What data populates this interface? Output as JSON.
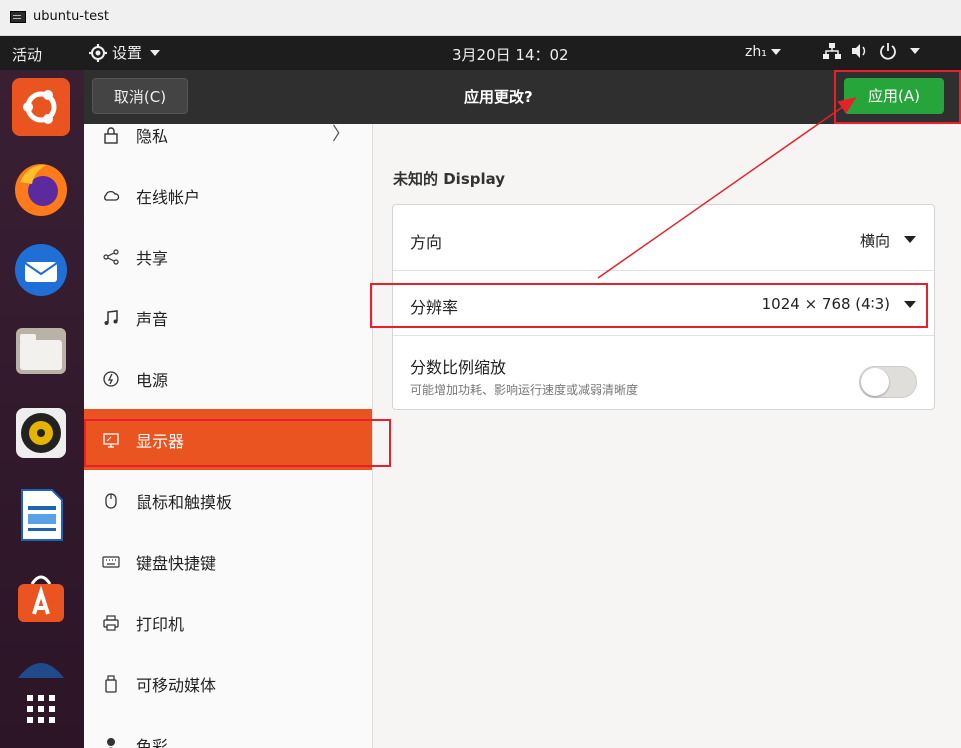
{
  "window": {
    "title": "ubuntu-test"
  },
  "topbar": {
    "activities": "活动",
    "app_menu": "设置",
    "clock": "3月20日 14：02",
    "input_method": "zh₁"
  },
  "header": {
    "cancel_label": "取消(C)",
    "title": "应用更改?",
    "apply_label": "应用(A)",
    "apply_color": "#26a53a"
  },
  "sidebar": {
    "accent_color": "#e95420",
    "items": [
      {
        "label": "隐私",
        "icon": "lock-icon"
      },
      {
        "label": "在线帐户",
        "icon": "cloud-icon"
      },
      {
        "label": "共享",
        "icon": "share-icon"
      },
      {
        "label": "声音",
        "icon": "music-note-icon"
      },
      {
        "label": "电源",
        "icon": "power-icon"
      },
      {
        "label": "显示器",
        "icon": "display-icon",
        "selected": true
      },
      {
        "label": "鼠标和触摸板",
        "icon": "mouse-icon"
      },
      {
        "label": "键盘快捷键",
        "icon": "keyboard-icon"
      },
      {
        "label": "打印机",
        "icon": "printer-icon"
      },
      {
        "label": "可移动媒体",
        "icon": "removable-media-icon"
      },
      {
        "label": "色彩",
        "icon": "color-icon"
      }
    ]
  },
  "display": {
    "name": "未知的 Display",
    "orientation": {
      "label": "方向",
      "value": "横向"
    },
    "resolution": {
      "label": "分辨率",
      "value": "1024 × 768 (4∶3)"
    },
    "fractional_scaling": {
      "label": "分数比例缩放",
      "hint": "可能增加功耗、影响运行速度或减弱清晰度",
      "enabled": false
    }
  },
  "annotation_color": "#e8202a"
}
